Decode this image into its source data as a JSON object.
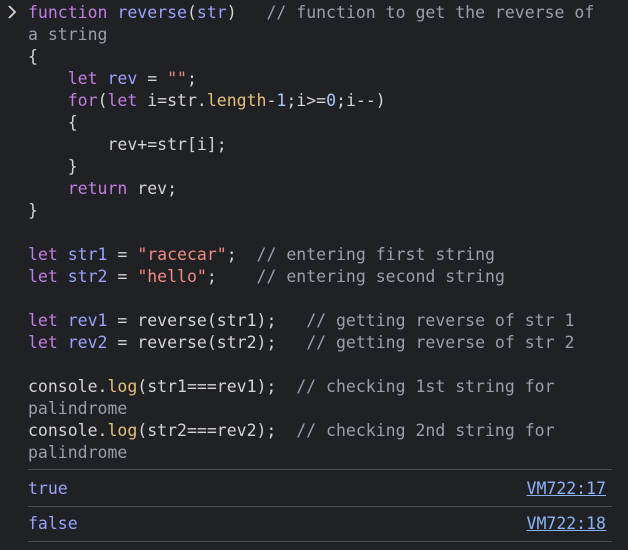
{
  "console": {
    "input_lines": [
      [
        {
          "t": "function ",
          "c": "keyword"
        },
        {
          "t": "reverse",
          "c": "decl"
        },
        {
          "t": "(",
          "c": "plain"
        },
        {
          "t": "str",
          "c": "decl"
        },
        {
          "t": ")   ",
          "c": "plain"
        },
        {
          "t": "// function to get the reverse of",
          "c": "comment"
        }
      ],
      [
        {
          "t": "a string",
          "c": "comment"
        }
      ],
      [
        {
          "t": "{",
          "c": "plain"
        }
      ],
      [
        {
          "t": "    ",
          "c": "plain"
        },
        {
          "t": "let",
          "c": "keyword"
        },
        {
          "t": " ",
          "c": "plain"
        },
        {
          "t": "rev",
          "c": "decl"
        },
        {
          "t": " = ",
          "c": "plain"
        },
        {
          "t": "\"\"",
          "c": "string"
        },
        {
          "t": ";",
          "c": "plain"
        }
      ],
      [
        {
          "t": "    ",
          "c": "plain"
        },
        {
          "t": "for",
          "c": "keyword"
        },
        {
          "t": "(",
          "c": "plain"
        },
        {
          "t": "let",
          "c": "keyword"
        },
        {
          "t": " i=str.",
          "c": "plain"
        },
        {
          "t": "length",
          "c": "property"
        },
        {
          "t": "-",
          "c": "plain"
        },
        {
          "t": "1",
          "c": "number"
        },
        {
          "t": ";i>=",
          "c": "plain"
        },
        {
          "t": "0",
          "c": "number"
        },
        {
          "t": ";i--)",
          "c": "plain"
        }
      ],
      [
        {
          "t": "    {",
          "c": "plain"
        }
      ],
      [
        {
          "t": "        rev+=str[i];",
          "c": "plain"
        }
      ],
      [
        {
          "t": "    }",
          "c": "plain"
        }
      ],
      [
        {
          "t": "    ",
          "c": "plain"
        },
        {
          "t": "return",
          "c": "keyword"
        },
        {
          "t": " rev;",
          "c": "plain"
        }
      ],
      [
        {
          "t": "}",
          "c": "plain"
        }
      ],
      [],
      [
        {
          "t": "let",
          "c": "keyword"
        },
        {
          "t": " ",
          "c": "plain"
        },
        {
          "t": "str1",
          "c": "decl"
        },
        {
          "t": " = ",
          "c": "plain"
        },
        {
          "t": "\"racecar\"",
          "c": "string"
        },
        {
          "t": ";  ",
          "c": "plain"
        },
        {
          "t": "// entering first string",
          "c": "comment"
        }
      ],
      [
        {
          "t": "let",
          "c": "keyword"
        },
        {
          "t": " ",
          "c": "plain"
        },
        {
          "t": "str2",
          "c": "decl"
        },
        {
          "t": " = ",
          "c": "plain"
        },
        {
          "t": "\"hello\"",
          "c": "string"
        },
        {
          "t": ";    ",
          "c": "plain"
        },
        {
          "t": "// entering second string",
          "c": "comment"
        }
      ],
      [],
      [
        {
          "t": "let",
          "c": "keyword"
        },
        {
          "t": " ",
          "c": "plain"
        },
        {
          "t": "rev1",
          "c": "decl"
        },
        {
          "t": " = reverse(str1);   ",
          "c": "plain"
        },
        {
          "t": "// getting reverse of str 1",
          "c": "comment"
        }
      ],
      [
        {
          "t": "let",
          "c": "keyword"
        },
        {
          "t": " ",
          "c": "plain"
        },
        {
          "t": "rev2",
          "c": "decl"
        },
        {
          "t": " = reverse(str2);   ",
          "c": "plain"
        },
        {
          "t": "// getting reverse of str 2",
          "c": "comment"
        }
      ],
      [],
      [
        {
          "t": "console.",
          "c": "plain"
        },
        {
          "t": "log",
          "c": "property"
        },
        {
          "t": "(str1===rev1);  ",
          "c": "plain"
        },
        {
          "t": "// checking 1st string for",
          "c": "comment"
        }
      ],
      [
        {
          "t": "palindrome",
          "c": "comment"
        }
      ],
      [
        {
          "t": "console.",
          "c": "plain"
        },
        {
          "t": "log",
          "c": "property"
        },
        {
          "t": "(str2===rev2);  ",
          "c": "plain"
        },
        {
          "t": "// checking 2nd string for",
          "c": "comment"
        }
      ],
      [
        {
          "t": "palindrome",
          "c": "comment"
        }
      ]
    ],
    "outputs": [
      {
        "value": "true",
        "source": "VM722:17"
      },
      {
        "value": "false",
        "source": "VM722:18"
      }
    ]
  },
  "icons": {
    "prompt": "chevron-right-icon"
  }
}
